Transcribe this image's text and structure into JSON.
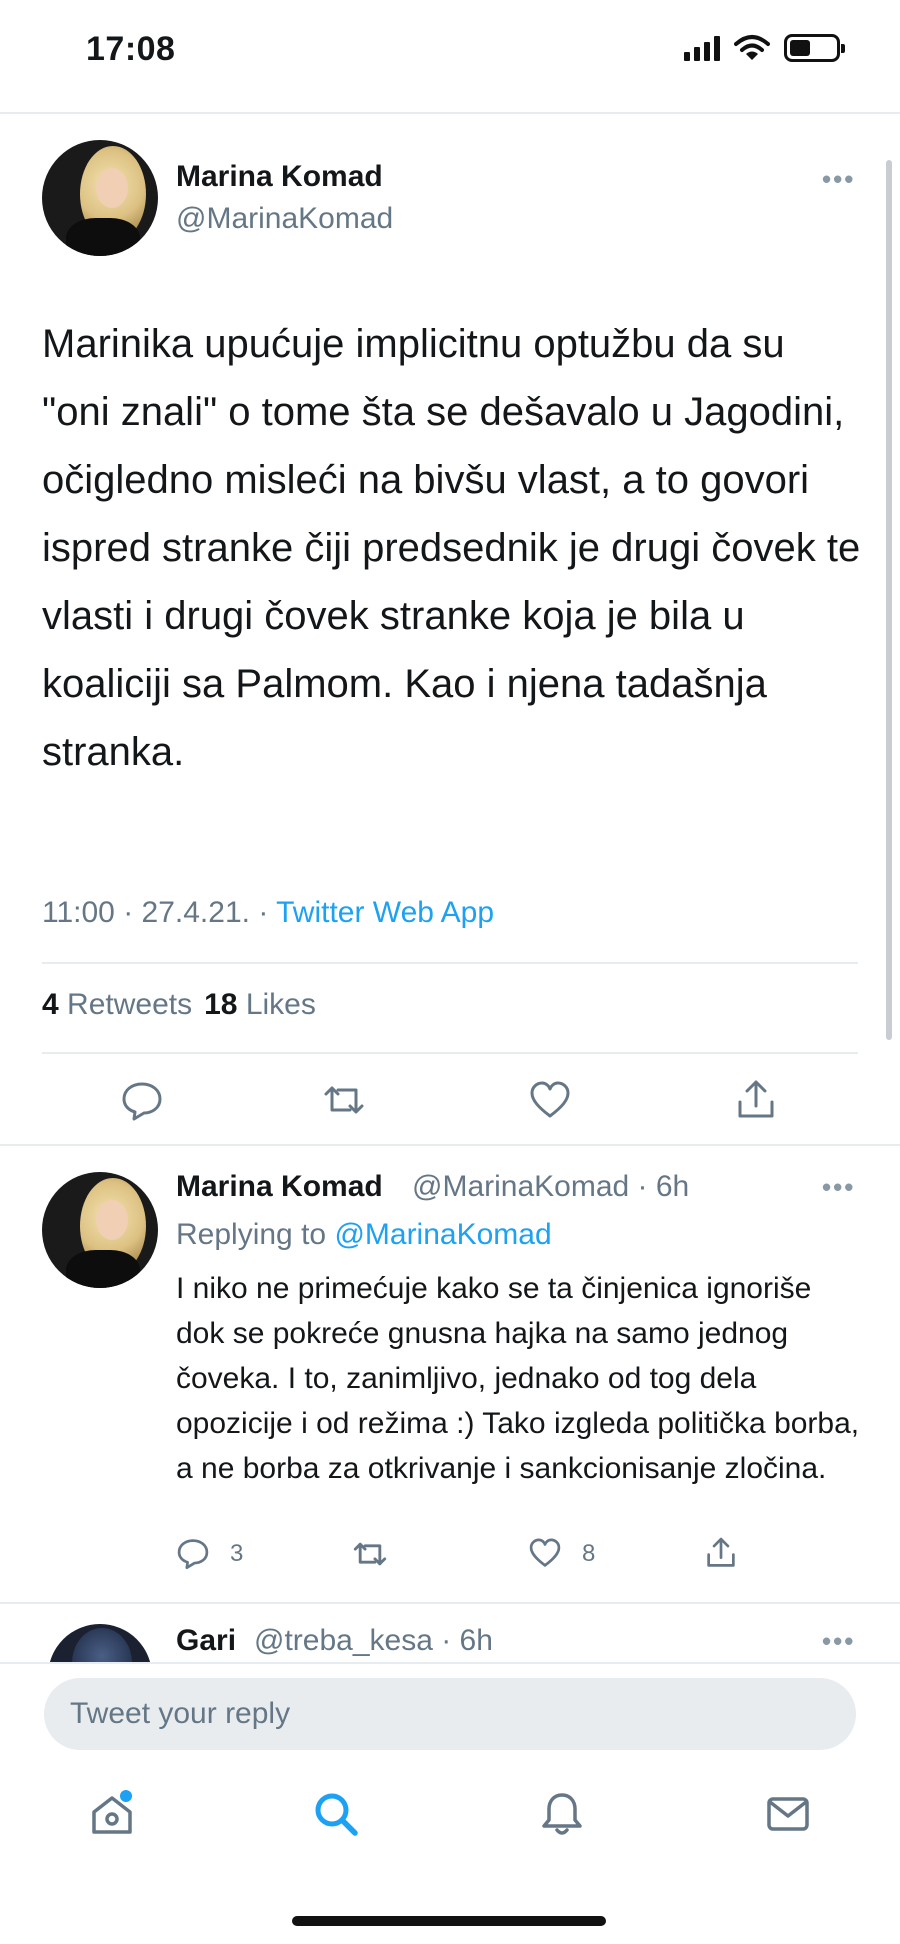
{
  "status_bar": {
    "time": "17:08",
    "icons": [
      "cellular-signal-icon",
      "wifi-icon",
      "battery-icon"
    ],
    "battery_level": 0.45
  },
  "main_tweet": {
    "author_name": "Marina Komad",
    "author_handle": "@MarinaKomad",
    "text": "Marinika upućuje implicitnu optužbu da su \"oni znali\" o tome šta se dešavalo u Jagodini, očigledno misleći na bivšu vlast, a to govori ispred stranke čiji predsednik je drugi čovek te vlasti i drugi čovek stranke koja je bila u koaliciji sa Palmom. Kao i njena tadašnja stranka.",
    "time": "11:00",
    "date": "27.4.21.",
    "separator": "·",
    "source_app": "Twitter Web App",
    "retweets_count": "4",
    "retweets_label": "Retweets",
    "likes_count": "18",
    "likes_label": "Likes",
    "actions": [
      "reply-icon",
      "retweet-icon",
      "like-icon",
      "share-icon"
    ]
  },
  "reply_tweet": {
    "author_name": "Marina Komad",
    "author_handle_time": "@MarinaKomad · 6h",
    "replying_prefix": "Replying to",
    "replying_to": "@MarinaKomad",
    "text": "I niko ne primećuje kako se ta činjenica ignoriše dok se pokreće gnusna hajka na samo jednog čoveka. I to, zanimljivo, jednako od tog dela opozicije i od režima :) Tako izgleda politička borba, a ne borba za otkrivanje i sankcionisanje zločina.",
    "reply_count": "3",
    "like_count": "8"
  },
  "next_reply": {
    "author_name": "Gari",
    "author_handle_time": "@treba_kesa · 6h"
  },
  "composer": {
    "placeholder": "Tweet your reply"
  },
  "bottom_nav": {
    "items": [
      "home-icon",
      "search-icon",
      "notifications-icon",
      "messages-icon"
    ],
    "active": "search-icon"
  },
  "colors": {
    "accent": "#1da1f2",
    "secondary_text": "#657786",
    "divider": "#e6ecf0"
  }
}
